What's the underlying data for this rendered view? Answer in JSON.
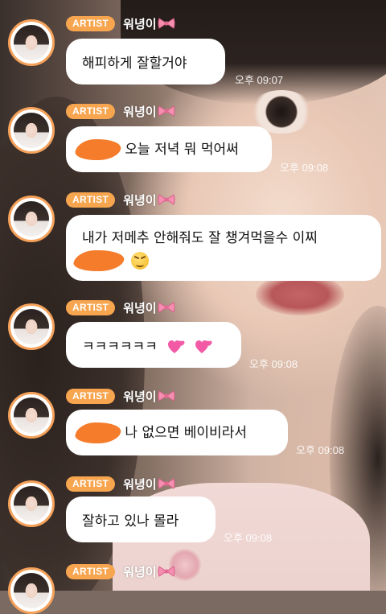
{
  "artist_badge": "ARTIST",
  "artist_name": "워녕이",
  "colors": {
    "badge": "#f7a54f",
    "avatar_ring": "#f5a15a",
    "scribble": "#f47c2b",
    "bubble": "#ffffff"
  },
  "messages": [
    {
      "text": "해피하게 잘할거야",
      "time": "오후 09:07"
    },
    {
      "text": "오늘 저녁 뭐 먹어써",
      "time": "오후 09:08",
      "redacted_prefix": true
    },
    {
      "line1": "내가 저메추 안해줘도 잘 챙겨먹을수 이찌",
      "emoji": "confounded-face-emoji",
      "redacted_prefix": true
    },
    {
      "text": "ㅋㅋㅋㅋㅋㅋ",
      "emoji": "two-hearts-emoji",
      "time": "오후 09:08"
    },
    {
      "text": "나 없으면 베이비라서",
      "time": "오후 09:08",
      "redacted_prefix": true
    },
    {
      "text": "잘하고 있나 몰라",
      "time": "오후 09:08"
    }
  ]
}
